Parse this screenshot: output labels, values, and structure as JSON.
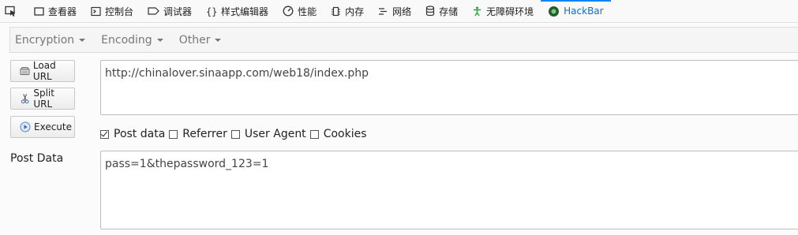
{
  "devtools": {
    "tabs": [
      {
        "label": "查看器"
      },
      {
        "label": "控制台"
      },
      {
        "label": "调试器"
      },
      {
        "label": "样式编辑器"
      },
      {
        "label": "性能"
      },
      {
        "label": "内存"
      },
      {
        "label": "网络"
      },
      {
        "label": "存储"
      },
      {
        "label": "无障碍环境"
      },
      {
        "label": "HackBar"
      }
    ],
    "active_tab": "HackBar"
  },
  "menubar": {
    "items": [
      {
        "label": "Encryption"
      },
      {
        "label": "Encoding"
      },
      {
        "label": "Other"
      }
    ]
  },
  "buttons": {
    "load_url": "Load URL",
    "split_url": "Split URL",
    "execute": "Execute"
  },
  "url_field": {
    "value": "http://chinalover.sinaapp.com/web18/index.php"
  },
  "options": {
    "post_data": {
      "label": "Post data",
      "checked": true
    },
    "referrer": {
      "label": "Referrer",
      "checked": false
    },
    "user_agent": {
      "label": "User Agent",
      "checked": false
    },
    "cookies": {
      "label": "Cookies",
      "checked": false
    }
  },
  "post_data_label": "Post Data",
  "post_data_field": {
    "value": "pass=1&thepassword_123=1"
  },
  "colors": {
    "accent": "#0a84ff",
    "active_text": "#0a6dd9"
  }
}
